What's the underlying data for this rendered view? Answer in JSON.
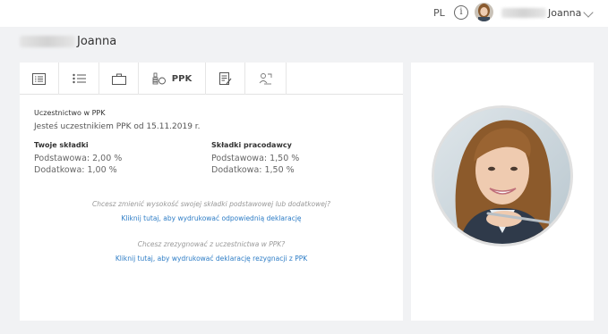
{
  "header": {
    "language": "PL",
    "info_icon_glyph": "i",
    "user_name": "Joanna"
  },
  "page": {
    "title": "Joanna"
  },
  "tabs": [
    {
      "icon": "list-detail-icon",
      "label": ""
    },
    {
      "icon": "bullet-list-icon",
      "label": ""
    },
    {
      "icon": "briefcase-icon",
      "label": ""
    },
    {
      "icon": "ppk-coins-icon",
      "label": "PPK"
    },
    {
      "icon": "document-edit-icon",
      "label": ""
    },
    {
      "icon": "people-swap-icon",
      "label": ""
    }
  ],
  "ppk": {
    "section_title": "Uczestnictwo w PPK",
    "status": "Jesteś uczestnikiem PPK od 15.11.2019 r.",
    "own": {
      "heading": "Twoje składki",
      "basic": "Podstawowa: 2,00 %",
      "additional": "Dodatkowa: 1,00 %"
    },
    "employer": {
      "heading": "Składki pracodawcy",
      "basic": "Podstawowa: 1,50 %",
      "additional": "Dodatkowa: 1,50 %"
    },
    "change_question": "Chcesz zmienić wysokość swojej składki podstawowej lub dodatkowej?",
    "change_link": "Kliknij tutaj, aby wydrukować odpowiednią deklarację",
    "resign_question": "Chcesz zrezygnować z uczestnictwa w PPK?",
    "resign_link": "Kliknij tutaj, aby wydrukować deklarację rezygnacji z PPK"
  },
  "colors": {
    "link": "#2e7dc6",
    "background": "#f1f2f4",
    "card": "#ffffff"
  }
}
